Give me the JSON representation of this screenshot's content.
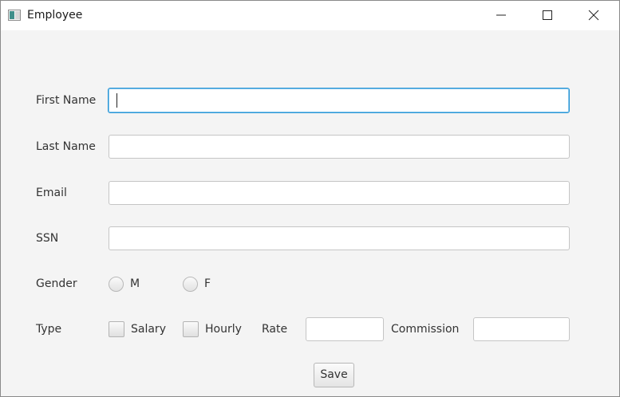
{
  "window": {
    "title": "Employee"
  },
  "form": {
    "first_name": {
      "label": "First Name",
      "value": ""
    },
    "last_name": {
      "label": "Last Name",
      "value": ""
    },
    "email": {
      "label": "Email",
      "value": ""
    },
    "ssn": {
      "label": "SSN",
      "value": ""
    },
    "gender": {
      "label": "Gender",
      "options": [
        "M",
        "F"
      ]
    },
    "type": {
      "label": "Type",
      "salary_label": "Salary",
      "hourly_label": "Hourly",
      "rate_label": "Rate",
      "rate_value": "",
      "commission_label": "Commission",
      "commission_value": ""
    },
    "save_label": "Save"
  }
}
